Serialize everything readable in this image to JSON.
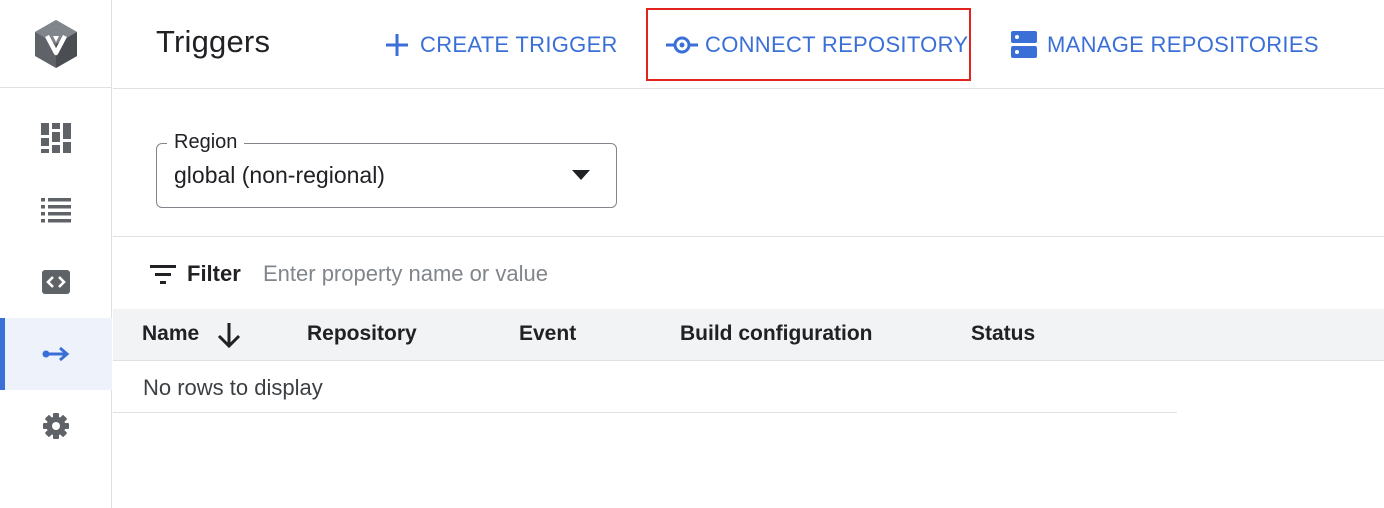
{
  "sidebar": {
    "logo_icon": "cloud-build-hexagon-icon",
    "items": [
      {
        "id": "dashboard",
        "icon": "dashboard-icon",
        "active": false
      },
      {
        "id": "history",
        "icon": "list-icon",
        "active": false
      },
      {
        "id": "repositories",
        "icon": "code-icon",
        "active": false
      },
      {
        "id": "triggers",
        "icon": "trigger-arrow-icon",
        "active": true
      },
      {
        "id": "settings",
        "icon": "gear-icon",
        "active": false
      }
    ]
  },
  "header": {
    "title": "Triggers",
    "create_trigger_label": "CREATE TRIGGER",
    "connect_repository_label": "CONNECT REPOSITORY",
    "manage_repositories_label": "MANAGE REPOSITORIES"
  },
  "region": {
    "label": "Region",
    "value": "global (non-regional)"
  },
  "filter": {
    "label": "Filter",
    "placeholder": "Enter property name or value"
  },
  "table": {
    "columns": [
      "Name",
      "Repository",
      "Event",
      "Build configuration",
      "Status"
    ],
    "sort_column": "Name",
    "sort_direction": "descending",
    "empty_message": "No rows to display"
  },
  "colors": {
    "accent": "#3b6fd8",
    "highlight_border": "#e3231e",
    "icon_gray": "#5f6368"
  }
}
